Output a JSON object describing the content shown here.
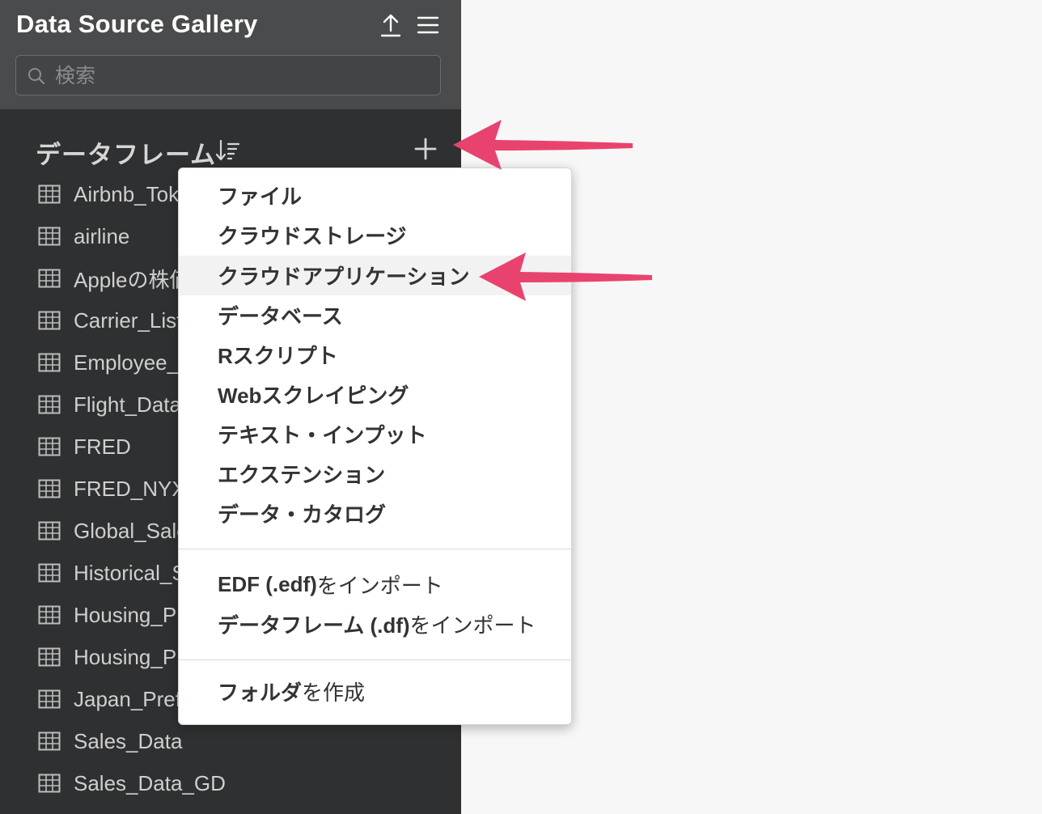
{
  "header": {
    "title": "Data Source Gallery",
    "upload_icon": "upload-icon",
    "menu_icon": "hamburger-menu-icon"
  },
  "search": {
    "placeholder": "検索",
    "value": ""
  },
  "section": {
    "title": "データフレーム",
    "sort_icon": "sort-icon",
    "add_icon": "plus-icon"
  },
  "dataframes": [
    "Airbnb_Tokyo",
    "airline",
    "Appleの株価",
    "Carrier_List",
    "Employee_",
    "Flight_Data",
    "FRED",
    "FRED_NYX",
    "Global_Sales",
    "Historical_S",
    "Housing_Pr",
    "Housing_Pr",
    "Japan_Pref",
    "Sales_Data",
    "Sales_Data_GD"
  ],
  "menu": {
    "items": [
      "ファイル",
      "クラウドストレージ",
      "クラウドアプリケーション",
      "データベース",
      "Rスクリプト",
      "Webスクレイピング",
      "テキスト・インプット",
      "エクステンション",
      "データ・カタログ"
    ],
    "import_items": [
      {
        "strong": "EDF (.edf)",
        "rest": " をインポート"
      },
      {
        "strong": "データフレーム (.df)",
        "rest": " をインポート"
      }
    ],
    "folder_item": {
      "strong": "フォルダ",
      "rest": "を作成"
    },
    "highlighted_index": 2
  },
  "colors": {
    "sidebar_bg": "#2f3031",
    "header_bg": "#4a4b4d",
    "arrow": "#e8436e"
  }
}
